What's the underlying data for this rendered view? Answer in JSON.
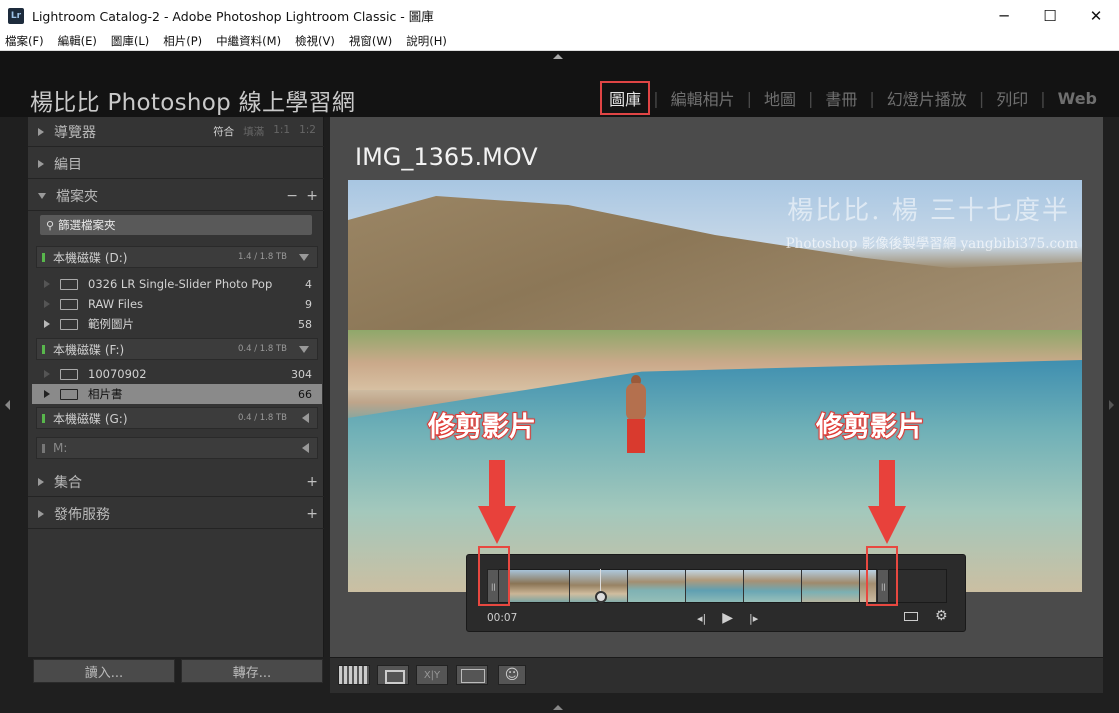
{
  "window": {
    "app_icon": "Lr",
    "title": "Lightroom Catalog-2 - Adobe Photoshop Lightroom Classic - 圖庫",
    "controls": [
      "─",
      "☐",
      "✕"
    ]
  },
  "menu": [
    "檔案(F)",
    "編輯(E)",
    "圖庫(L)",
    "相片(P)",
    "中繼資料(M)",
    "檢視(V)",
    "視窗(W)",
    "說明(H)"
  ],
  "identity_plate": "楊比比 Photoshop 線上學習網",
  "modules": {
    "library": "圖庫",
    "develop": "編輯相片",
    "map": "地圖",
    "book": "書冊",
    "slideshow": "幻燈片播放",
    "print": "列印",
    "web": "Web",
    "separator": "|"
  },
  "left_panel": {
    "navigator": {
      "title": "導覽器",
      "zoom": [
        "符合",
        "填滿",
        "1:1",
        "1:2"
      ],
      "selected_zoom": "符合"
    },
    "catalog": {
      "title": "編目"
    },
    "folders": {
      "title": "檔案夾",
      "minus": "−",
      "plus": "+",
      "filter_placeholder": "篩選檔案夾",
      "volumes": [
        {
          "name": "本機磁碟 (D:)",
          "size": "1.4 / 1.8 TB"
        },
        {
          "name": "本機磁碟 (F:)",
          "size": "0.4 / 1.8 TB"
        },
        {
          "name": "本機磁碟 (G:)",
          "size": "0.4 / 1.8 TB"
        },
        {
          "name": "M:",
          "size": ""
        }
      ],
      "folders_d": [
        {
          "name": "0326 LR Single-Slider Photo Pop",
          "count": "4"
        },
        {
          "name": "RAW Files",
          "count": "9"
        },
        {
          "name": "範例圖片",
          "count": "58"
        }
      ],
      "folders_f": [
        {
          "name": "10070902",
          "count": "304"
        },
        {
          "name": "相片書",
          "count": "66"
        }
      ]
    },
    "collections": {
      "title": "集合",
      "plus": "+"
    },
    "publish": {
      "title": "發佈服務",
      "plus": "+"
    },
    "import_label": "讀入...",
    "export_label": "轉存..."
  },
  "viewer": {
    "filename": "IMG_1365.MOV",
    "watermark_line1": "楊比比. 楊 三十七度半",
    "watermark_line2": "Photoshop 影像後製學習網 yangbibi375.com",
    "annotation_left": "修剪影片",
    "annotation_right": "修剪影片",
    "timecode": "00:07",
    "controls": {
      "prev": "◂|",
      "play": "▶",
      "next": "|▸",
      "gear": "⚙"
    }
  },
  "toolbar": {
    "compare_label": "X|Y"
  },
  "colors": {
    "annotation": "#e8413b",
    "active_module_box": "#e04545",
    "panel_bg": "#343434"
  }
}
